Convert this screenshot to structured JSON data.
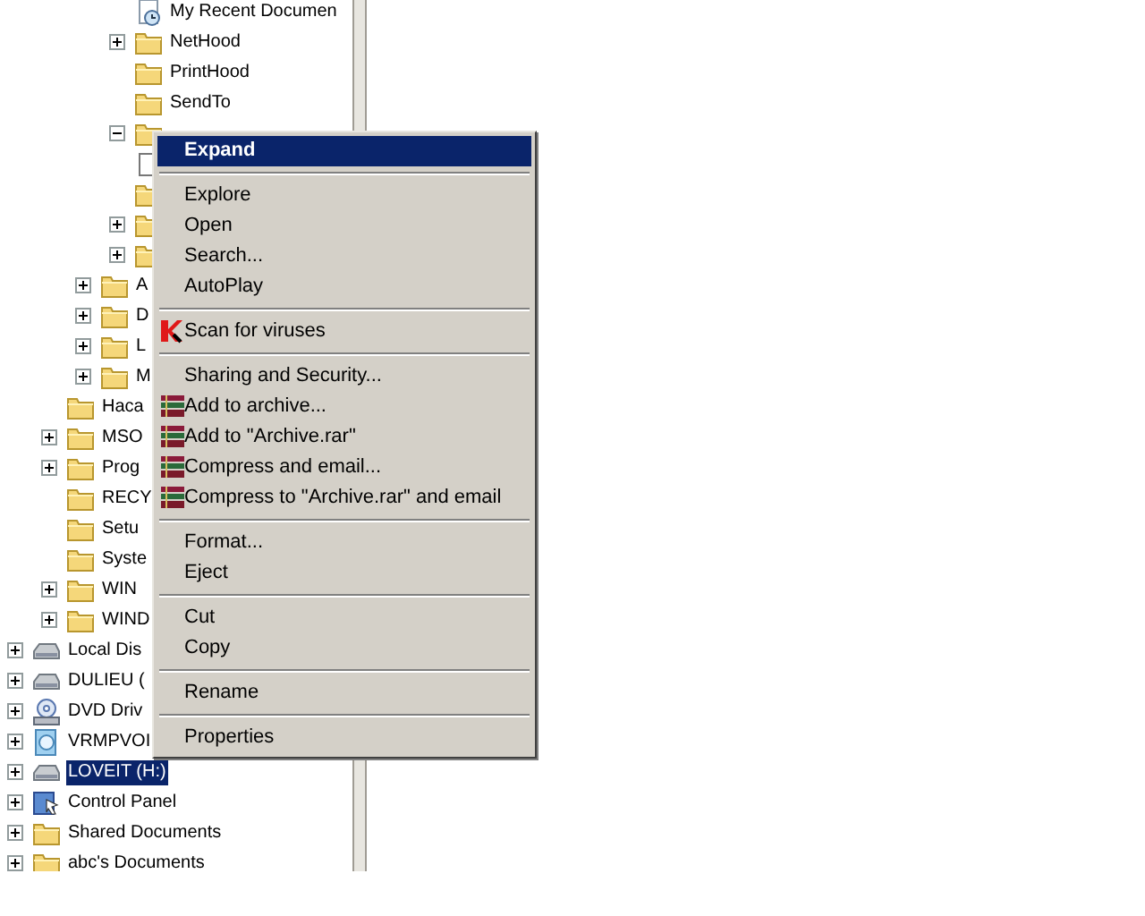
{
  "tree": [
    {
      "kind": "offscreen",
      "children": [
        {
          "kind": "offscreen",
          "children": [
            {
              "kind": "offscreen",
              "children": [
                {
                  "kind": "recent",
                  "label": "My Recent Documen"
                },
                {
                  "kind": "folder",
                  "label": "NetHood",
                  "expanded": false
                },
                {
                  "kind": "folder",
                  "label": "PrintHood"
                },
                {
                  "kind": "folder",
                  "label": "SendTo"
                },
                {
                  "kind": "folder",
                  "expanded": true
                },
                {
                  "kind": "file"
                },
                {
                  "kind": "folder"
                },
                {
                  "kind": "folder",
                  "expanded": false
                },
                {
                  "kind": "folder",
                  "expanded": false
                }
              ]
            },
            {
              "kind": "folder",
              "label": "A",
              "expanded": false
            },
            {
              "kind": "folder",
              "label": "D",
              "expanded": false
            },
            {
              "kind": "folder",
              "label": "L",
              "expanded": false
            },
            {
              "kind": "folder",
              "label": "M",
              "expanded": false
            }
          ]
        },
        {
          "kind": "folder",
          "label": "Haca"
        },
        {
          "kind": "folder",
          "label": "MSO",
          "expanded": false
        },
        {
          "kind": "folder",
          "label": "Prog",
          "expanded": false
        },
        {
          "kind": "folder",
          "label": "RECY"
        },
        {
          "kind": "folder",
          "label": "Setu"
        },
        {
          "kind": "folder",
          "label": "Syste"
        },
        {
          "kind": "folder",
          "label": "WIN",
          "expanded": false
        },
        {
          "kind": "folder",
          "label": "WIND",
          "expanded": false
        }
      ]
    },
    {
      "kind": "drive",
      "label": "Local Dis",
      "expanded": false,
      "selected": false
    },
    {
      "kind": "drive",
      "label": "DULIEU (",
      "expanded": false,
      "selected": false
    },
    {
      "kind": "dvd",
      "label": "DVD Driv",
      "expanded": false,
      "selected": false
    },
    {
      "kind": "cd",
      "label": "VRMPVOI",
      "expanded": false,
      "selected": false
    },
    {
      "kind": "drive",
      "label": "LOVEIT (H:)",
      "expanded": false,
      "selected": true
    },
    {
      "kind": "control",
      "label": "Control Panel",
      "expanded": false,
      "selected": false
    },
    {
      "kind": "folder",
      "label": "Shared Documents",
      "expanded": false,
      "selected": false
    },
    {
      "kind": "folder",
      "label": "abc's Documents",
      "expanded": false,
      "selected": false
    }
  ],
  "context_menu": [
    {
      "kind": "item",
      "label": "Expand",
      "default": true,
      "selected": true
    },
    {
      "kind": "separator"
    },
    {
      "kind": "item",
      "label": "Explore",
      "default": false,
      "selected": false
    },
    {
      "kind": "item",
      "label": "Open",
      "default": false,
      "selected": false
    },
    {
      "kind": "item",
      "label": "Search...",
      "default": false,
      "selected": false
    },
    {
      "kind": "item",
      "label": "AutoPlay",
      "default": false,
      "selected": false
    },
    {
      "kind": "separator"
    },
    {
      "kind": "antivirus-item",
      "label": "Scan for viruses",
      "default": false,
      "selected": false
    },
    {
      "kind": "separator"
    },
    {
      "kind": "item",
      "label": "Sharing and Security...",
      "default": false,
      "selected": false
    },
    {
      "kind": "archive-item",
      "label": "Add to archive...",
      "default": false,
      "selected": false
    },
    {
      "kind": "archive-item",
      "label": "Add to \"Archive.rar\"",
      "default": false,
      "selected": false
    },
    {
      "kind": "archive-item",
      "label": "Compress and email...",
      "default": false,
      "selected": false
    },
    {
      "kind": "archive-item",
      "label": "Compress to \"Archive.rar\" and email",
      "default": false,
      "selected": false
    },
    {
      "kind": "separator"
    },
    {
      "kind": "item",
      "label": "Format...",
      "default": false,
      "selected": false
    },
    {
      "kind": "item",
      "label": "Eject",
      "default": false,
      "selected": false
    },
    {
      "kind": "separator"
    },
    {
      "kind": "item",
      "label": "Cut",
      "default": false,
      "selected": false
    },
    {
      "kind": "item",
      "label": "Copy",
      "default": false,
      "selected": false
    },
    {
      "kind": "separator"
    },
    {
      "kind": "item",
      "label": "Rename",
      "default": false,
      "selected": false
    },
    {
      "kind": "separator"
    },
    {
      "kind": "item",
      "label": "Properties",
      "default": false,
      "selected": false
    }
  ]
}
